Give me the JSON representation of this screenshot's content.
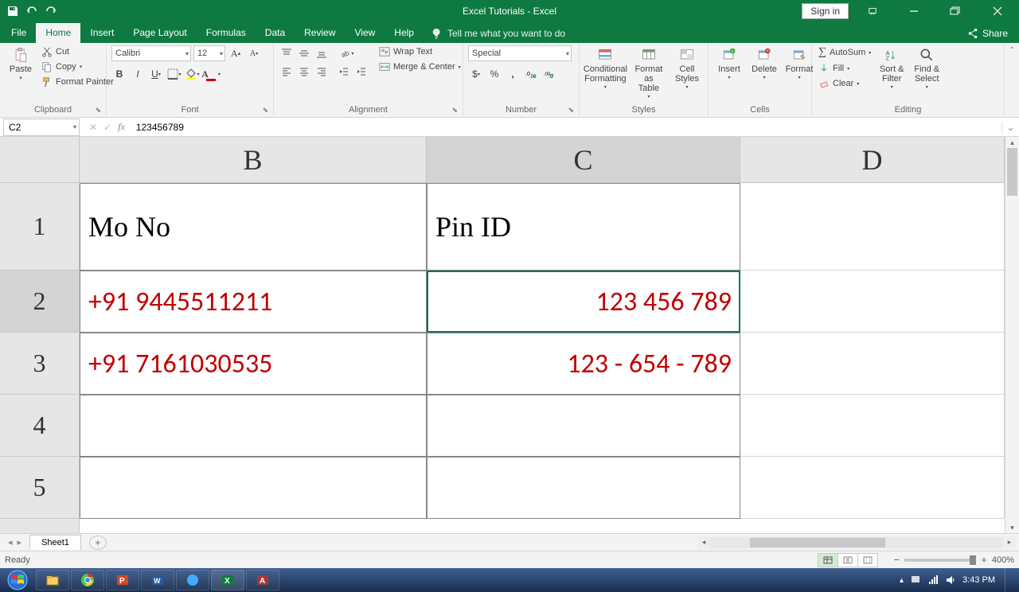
{
  "titlebar": {
    "title": "Excel Tutorials - Excel",
    "signin": "Sign in"
  },
  "tabs": {
    "items": [
      "File",
      "Home",
      "Insert",
      "Page Layout",
      "Formulas",
      "Data",
      "Review",
      "View",
      "Help"
    ],
    "active": "Home",
    "tell": "Tell me what you want to do",
    "share": "Share"
  },
  "ribbon": {
    "clipboard": {
      "paste": "Paste",
      "cut": "Cut",
      "copy": "Copy",
      "painter": "Format Painter",
      "label": "Clipboard"
    },
    "font": {
      "name": "Calibri",
      "size": "12",
      "label": "Font"
    },
    "alignment": {
      "wrap": "Wrap Text",
      "merge": "Merge & Center",
      "label": "Alignment"
    },
    "number": {
      "format": "Special",
      "label": "Number"
    },
    "styles": {
      "cond": "Conditional\nFormatting",
      "table": "Format as\nTable",
      "cell": "Cell\nStyles",
      "label": "Styles"
    },
    "cells": {
      "insert": "Insert",
      "delete": "Delete",
      "format": "Format",
      "label": "Cells"
    },
    "editing": {
      "autosum": "AutoSum",
      "fill": "Fill",
      "clear": "Clear",
      "sort": "Sort &\nFilter",
      "find": "Find &\nSelect",
      "label": "Editing"
    }
  },
  "formulabar": {
    "namebox": "C2",
    "value": "123456789"
  },
  "columns": [
    "B",
    "C",
    "D"
  ],
  "rows": [
    "1",
    "2",
    "3",
    "4",
    "5"
  ],
  "cells": {
    "B1": "Mo No",
    "C1": "Pin ID",
    "B2": "+91 9445511211",
    "C2": "123 456 789",
    "B3": "+91 7161030535",
    "C3": "123 - 654 - 789"
  },
  "sheet": {
    "name": "Sheet1"
  },
  "status": {
    "ready": "Ready",
    "zoom": "400%"
  },
  "taskbar": {
    "time": "3:43 PM",
    "date": ""
  }
}
